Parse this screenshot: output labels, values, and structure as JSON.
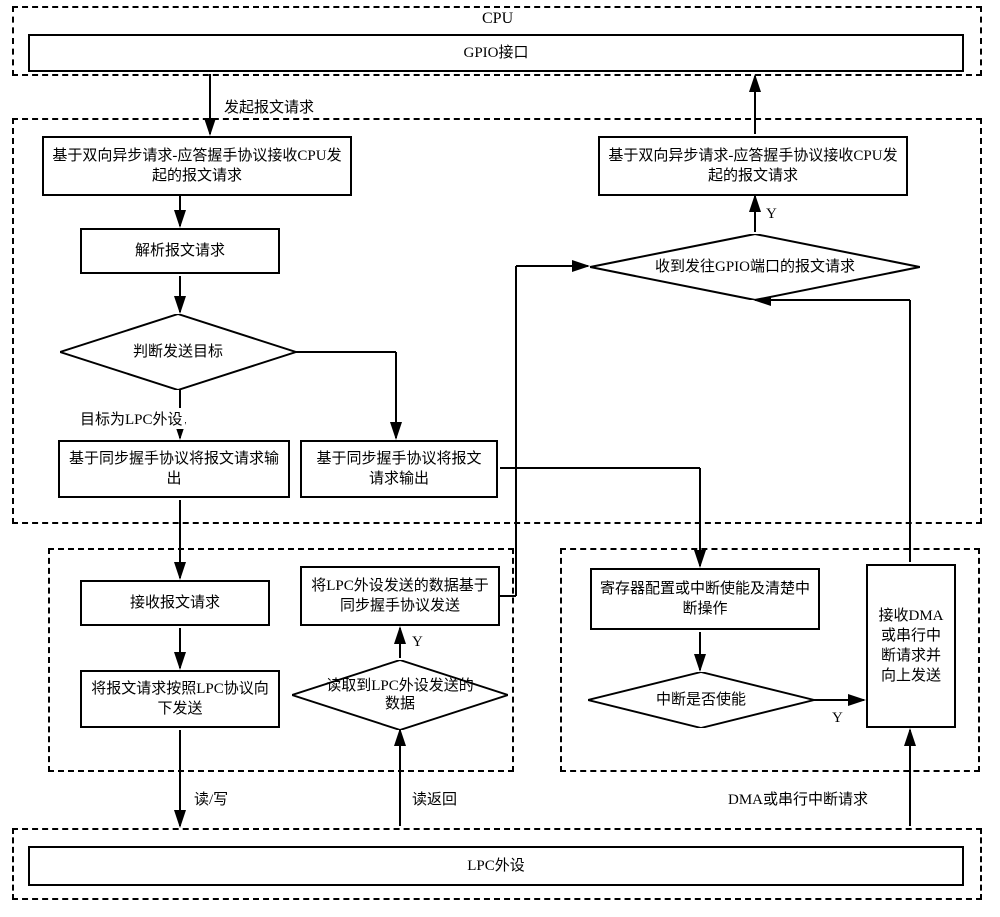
{
  "top": {
    "cpu": "CPU",
    "gpio": "GPIO接口"
  },
  "labels": {
    "send_request": "发起报文请求",
    "target_lpc": "目标为LPC外设",
    "read_write": "读/写",
    "read_return": "读返回",
    "dma_serial": "DMA或串行中断请求",
    "y1": "Y",
    "y2": "Y",
    "y3": "Y"
  },
  "left": {
    "recv_cpu": "基于双向异步请求-应答握手协议接收CPU发起的报文请求",
    "parse": "解析报文请求",
    "judge": "判断发送目标",
    "out_lpc": "基于同步握手协议将报文请求输出",
    "out_other": "基于同步握手协议将报文请求输出"
  },
  "right_top": {
    "recv_cpu2": "基于双向异步请求-应答握手协议接收CPU发起的报文请求",
    "gpio_req": "收到发往GPIO端口的报文请求"
  },
  "bottom_left": {
    "recv_req": "接收报文请求",
    "send_lpc": "将报文请求按照LPC协议向下发送",
    "send_sync": "将LPC外设发送的数据基于同步握手协议发送",
    "read_lpc": "读取到LPC外设发送的数据"
  },
  "bottom_right": {
    "reg_cfg": "寄存器配置或中断使能及清楚中断操作",
    "int_enable": "中断是否使能",
    "recv_dma": "接收DMA或串行中断请求并向上发送"
  },
  "bottom": {
    "lpc_dev": "LPC外设"
  }
}
